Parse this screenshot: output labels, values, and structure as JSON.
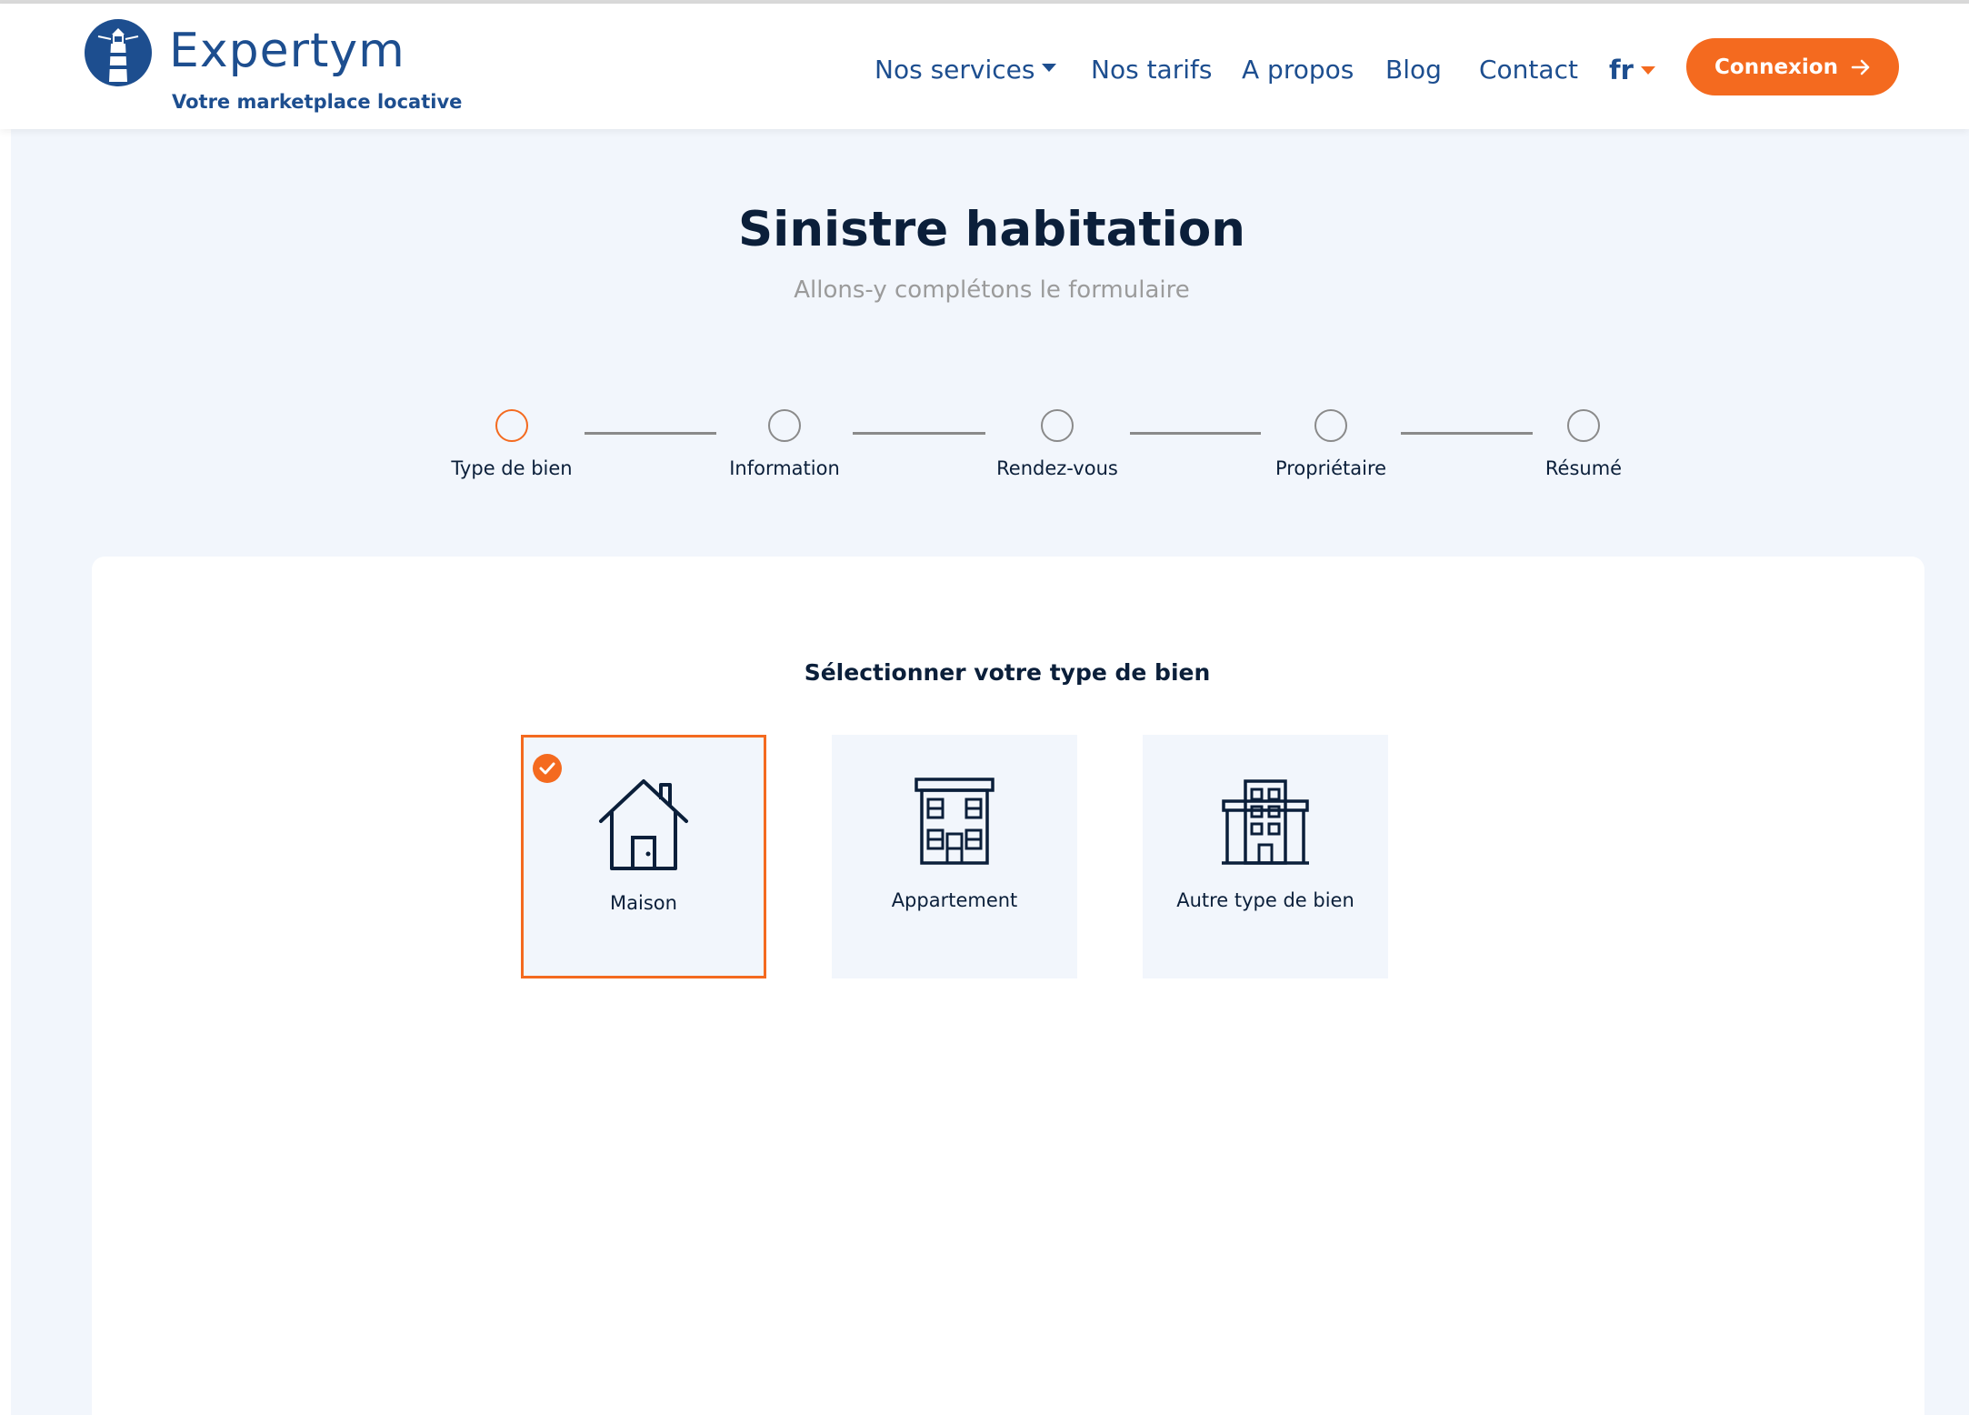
{
  "header": {
    "brand": "Expertym",
    "tagline": "Votre marketplace locative",
    "nav": [
      {
        "label": "Nos services",
        "has_dropdown": true
      },
      {
        "label": "Nos tarifs"
      },
      {
        "label": "A propos"
      },
      {
        "label": "Blog"
      },
      {
        "label": "Contact"
      }
    ],
    "language": "fr",
    "login_label": "Connexion"
  },
  "page": {
    "title": "Sinistre habitation",
    "subtitle": "Allons-y complétons le formulaire"
  },
  "stepper": {
    "steps": [
      {
        "label": "Type de bien",
        "active": true
      },
      {
        "label": "Information",
        "active": false
      },
      {
        "label": "Rendez-vous",
        "active": false
      },
      {
        "label": "Propriétaire",
        "active": false
      },
      {
        "label": "Résumé",
        "active": false
      }
    ]
  },
  "form": {
    "title": "Sélectionner votre type de bien",
    "options": [
      {
        "label": "Maison",
        "icon": "house-icon",
        "selected": true
      },
      {
        "label": "Appartement",
        "icon": "apartment-building-icon",
        "selected": false
      },
      {
        "label": "Autre type de bien",
        "icon": "office-building-icon",
        "selected": false
      }
    ]
  },
  "colors": {
    "accent": "#f46a1f",
    "brand": "#1d4e8f",
    "text_dark": "#0b1f3a",
    "background": "#f2f6fc"
  }
}
